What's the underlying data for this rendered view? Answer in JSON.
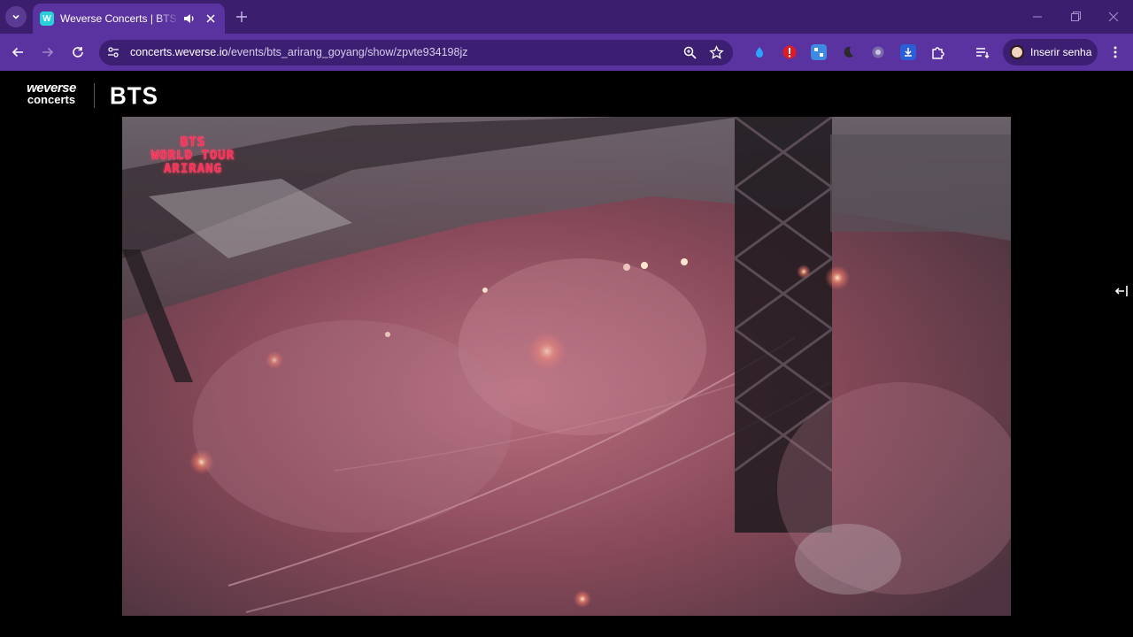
{
  "browser": {
    "tab_title": "Weverse Concerts | BTS WORLD TOUR ARIRANG",
    "favicon_text": "W",
    "url_host": "concerts.weverse.io",
    "url_path": "/events/bts_arirang_goyang/show/zpvte934198jz",
    "profile_label": "Inserir senha",
    "theme_color": "#5b33a0",
    "icons": [
      "tab-search-icon",
      "audio-playing-icon",
      "close-tab-icon",
      "new-tab-icon",
      "minimize-icon",
      "restore-icon",
      "close-window-icon",
      "back-icon",
      "forward-icon",
      "reload-icon",
      "site-info-icon",
      "zoom-icon",
      "bookmark-star-icon",
      "extensions-icon",
      "reading-list-icon",
      "menu-icon"
    ]
  },
  "header": {
    "brand_line1": "weverse",
    "brand_line2": "concerts",
    "artist": "BTS"
  },
  "player": {
    "overlay_lines": [
      "BTS",
      "WORLD TOUR",
      "ARIRANG"
    ]
  }
}
